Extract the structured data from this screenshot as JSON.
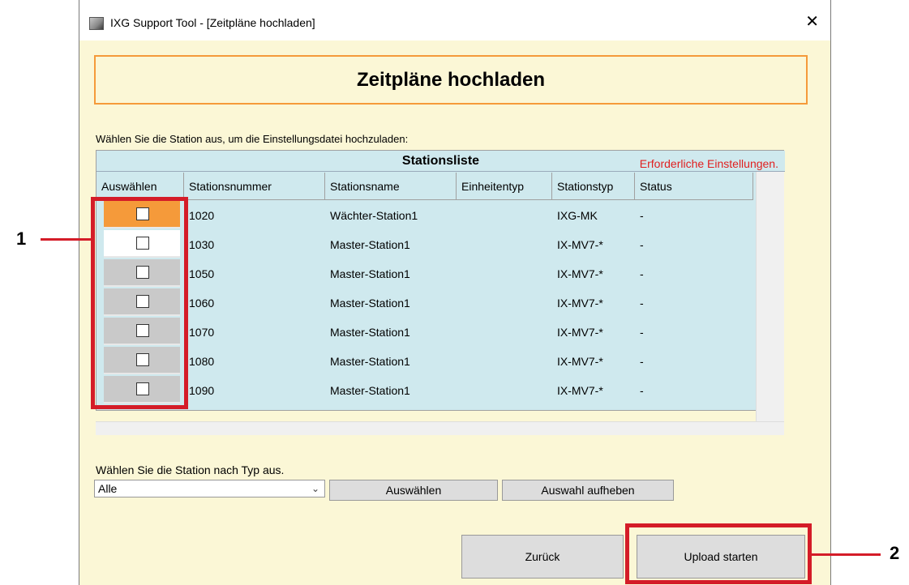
{
  "window": {
    "title": "IXG Support Tool - [Zeitpläne hochladen]",
    "close_glyph": "✕"
  },
  "heading": "Zeitpläne hochladen",
  "instruction": "Wählen Sie die Station aus, um die Einstellungsdatei hochzuladen:",
  "grid": {
    "title": "Stationsliste",
    "required_note": "Erforderliche Einstellungen.",
    "columns": [
      "Auswählen",
      "Stationsnummer",
      "Stationsname",
      "Einheitentyp",
      "Stationstyp",
      "Status"
    ],
    "rows": [
      {
        "number": "1020",
        "name": "Wächter-Station1",
        "unit": "",
        "type": "IXG-MK",
        "status": "-",
        "checked": false,
        "selected": true
      },
      {
        "number": "1030",
        "name": "Master-Station1",
        "unit": "",
        "type": "IX-MV7-*",
        "status": "-",
        "checked": false,
        "selected": false
      },
      {
        "number": "1050",
        "name": "Master-Station1",
        "unit": "",
        "type": "IX-MV7-*",
        "status": "-",
        "checked": false,
        "selected": false
      },
      {
        "number": "1060",
        "name": "Master-Station1",
        "unit": "",
        "type": "IX-MV7-*",
        "status": "-",
        "checked": false,
        "selected": false
      },
      {
        "number": "1070",
        "name": "Master-Station1",
        "unit": "",
        "type": "IX-MV7-*",
        "status": "-",
        "checked": false,
        "selected": false
      },
      {
        "number": "1080",
        "name": "Master-Station1",
        "unit": "",
        "type": "IX-MV7-*",
        "status": "-",
        "checked": false,
        "selected": false
      },
      {
        "number": "1090",
        "name": "Master-Station1",
        "unit": "",
        "type": "IX-MV7-*",
        "status": "-",
        "checked": false,
        "selected": false
      }
    ]
  },
  "type_select": {
    "label": "Wählen Sie die Station nach Typ aus.",
    "value": "Alle",
    "select_button": "Auswählen",
    "deselect_button": "Auswahl aufheben"
  },
  "footer": {
    "back_button": "Zurück",
    "upload_button": "Upload starten"
  },
  "callouts": [
    "1",
    "2"
  ],
  "colors": {
    "accent": "#f59a3a",
    "highlight": "#d41c28",
    "grid_bg": "#cfe9ee",
    "window_bg": "#fbf7d6"
  }
}
